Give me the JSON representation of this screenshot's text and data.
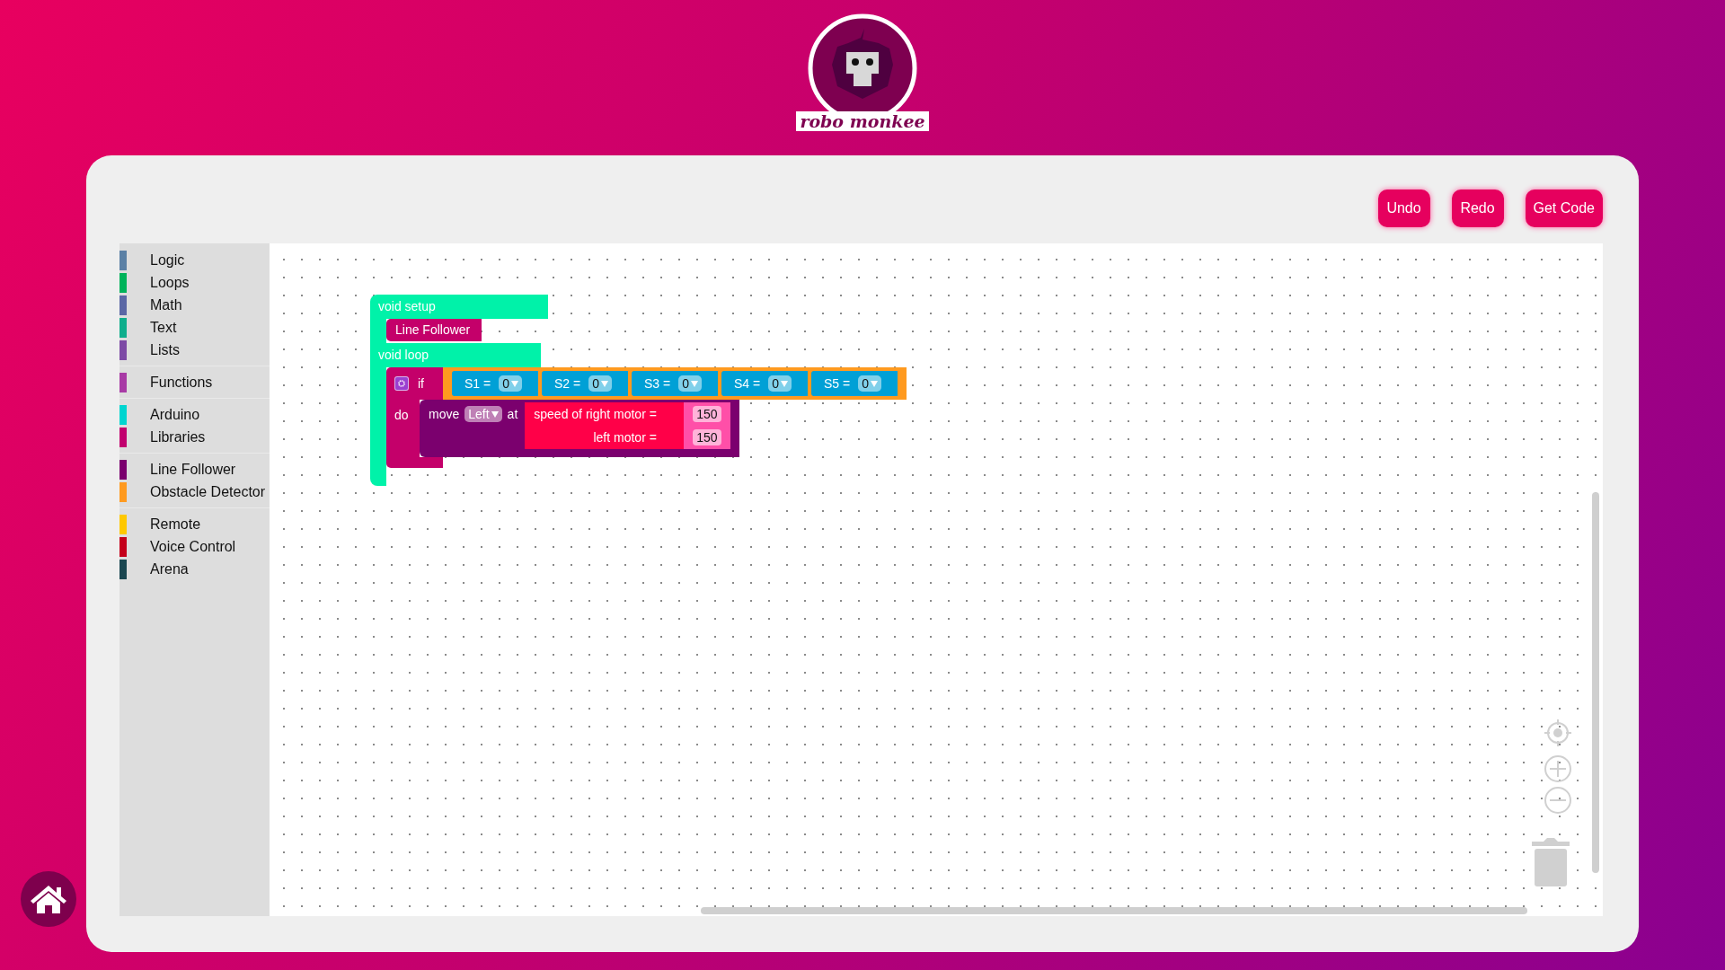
{
  "logo": {
    "text": "robo monkee"
  },
  "buttons": [
    "Undo",
    "Redo",
    "Get Code"
  ],
  "toolbox": {
    "groups": [
      [
        {
          "label": "Logic",
          "color": "#5b80a5"
        },
        {
          "label": "Loops",
          "color": "#00b35a"
        },
        {
          "label": "Math",
          "color": "#5b67a5"
        },
        {
          "label": "Text",
          "color": "#0fae8c"
        },
        {
          "label": "Lists",
          "color": "#7d4aa5"
        }
      ],
      [
        {
          "label": "Functions",
          "color": "#a83aa5"
        }
      ],
      [
        {
          "label": "Arduino",
          "color": "#00d5d0"
        },
        {
          "label": "Libraries",
          "color": "#c1006e"
        }
      ],
      [
        {
          "label": "Line Follower",
          "color": "#7b006e"
        },
        {
          "label": "Obstacle Detector",
          "color": "#ff9a1f"
        }
      ],
      [
        {
          "label": "Remote",
          "color": "#ffc800"
        },
        {
          "label": "Voice Control",
          "color": "#c4001a"
        },
        {
          "label": "Arena",
          "color": "#1a4650"
        }
      ]
    ]
  },
  "workspace": {
    "setup_block": {
      "label": "void setup",
      "children": [
        "Line Follower"
      ]
    },
    "loop_block": {
      "label": "void loop",
      "if_block": {
        "keyword": "if",
        "do_label": "do",
        "conditions": [
          {
            "label": "S1 =",
            "value": "0"
          },
          {
            "label": "S2 =",
            "value": "0"
          },
          {
            "label": "S3 =",
            "value": "0"
          },
          {
            "label": "S4 =",
            "value": "0"
          },
          {
            "label": "S5 =",
            "value": "0"
          }
        ],
        "action": {
          "label": "move",
          "direction": "Left",
          "at_label": "at",
          "speeds": [
            {
              "label": "speed of right motor =",
              "value": "150"
            },
            {
              "label": "left motor =",
              "value": "150"
            }
          ]
        }
      }
    }
  }
}
